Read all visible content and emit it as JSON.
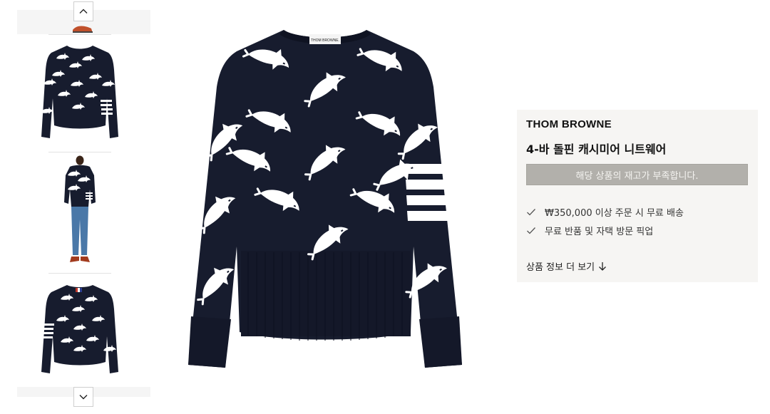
{
  "gallery": {
    "scroll_up_icon": "chevron-up-icon",
    "scroll_down_icon": "chevron-down-icon",
    "thumbnails": [
      "thumbnail-front-flat",
      "thumbnail-model-full",
      "thumbnail-back-flat"
    ]
  },
  "product": {
    "brand": "THOM BROWNE",
    "name": "4-바 돌핀 캐시미어 니트웨어",
    "stock_status": "해당 상품의 재고가 부족합니다.",
    "benefits": [
      "₩350,000 이상 주문 시 무료 배송",
      "무료 반품 및 자택 방문 픽업"
    ],
    "more_info_label": "상품 정보 더 보기",
    "more_info_icon": "arrow-down-icon",
    "label_text": "THOM BROWNE.",
    "colors": {
      "sweater_navy": "#171c2e",
      "panel_bg": "#f6f5f3",
      "soldout_bg": "#b2b0ab"
    }
  }
}
